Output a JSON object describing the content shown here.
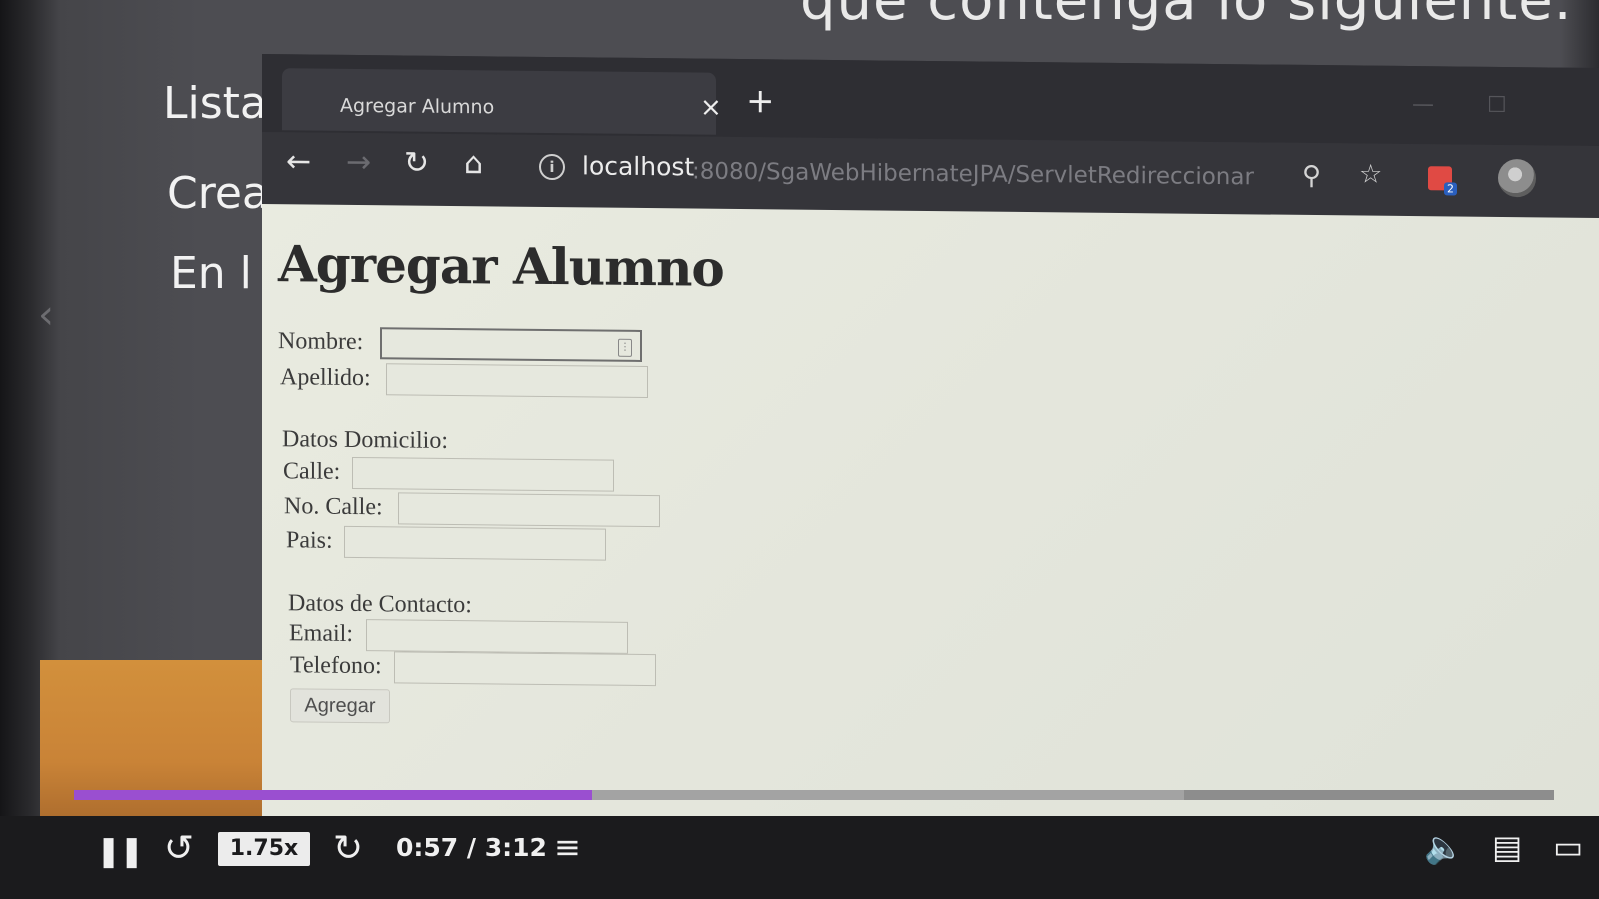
{
  "slide": {
    "top_text": "que contenga lo siguiente.",
    "items": [
      "Lista",
      "Crea",
      "En l"
    ]
  },
  "browser": {
    "tab_title": "Agregar Alumno",
    "tab_close": "×",
    "new_tab": "+",
    "url_host": "localhost",
    "url_path": ":8080/SgaWebHibernateJPA/ServletRedireccionar",
    "extension_badge": "2"
  },
  "page": {
    "title": "Agregar Alumno",
    "labels": {
      "nombre": "Nombre:",
      "apellido": "Apellido:",
      "domicilio": "Datos Domicilio:",
      "calle": "Calle:",
      "no_calle": "No. Calle:",
      "pais": "Pais:",
      "contacto": "Datos de Contacto:",
      "email": "Email:",
      "telefono": "Telefono:"
    },
    "values": {
      "nombre": "",
      "apellido": "",
      "calle": "",
      "no_calle": "",
      "pais": "",
      "email": "",
      "telefono": ""
    },
    "submit": "Agregar"
  },
  "player": {
    "speed": "1.75x",
    "time": "0:57 / 3:12",
    "progress_fraction": 0.35,
    "buffer_fraction": 0.75,
    "progress_color": "#9a4fd0"
  },
  "icons": {
    "back": "back-arrow-icon",
    "forward": "forward-arrow-icon",
    "reload": "reload-icon",
    "home": "home-icon",
    "info": "info-icon",
    "search": "search-icon",
    "star": "star-icon",
    "pause": "pause-icon",
    "rewind": "rewind-icon",
    "forward_skip": "skip-forward-icon",
    "notes": "notes-icon",
    "volume": "volume-icon",
    "transcript": "transcript-icon"
  }
}
